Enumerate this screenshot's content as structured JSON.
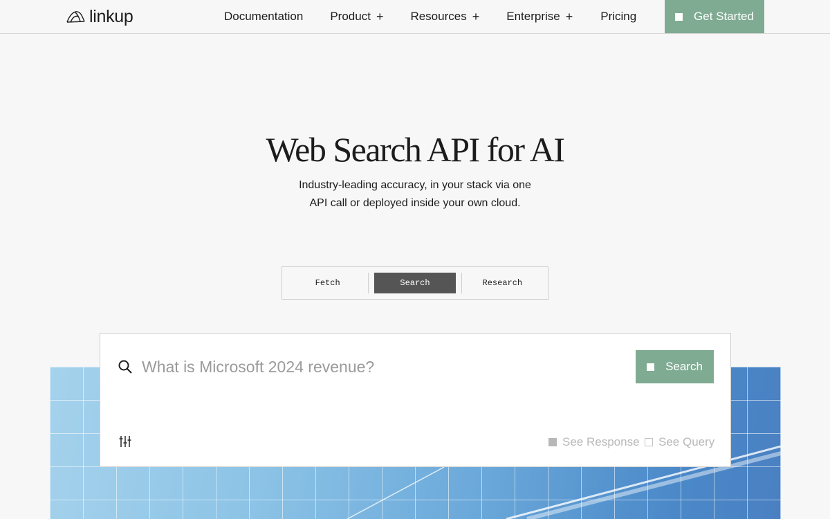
{
  "header": {
    "logo_text": "linkup",
    "nav": [
      {
        "label": "Documentation",
        "has_plus": false
      },
      {
        "label": "Product",
        "has_plus": true
      },
      {
        "label": "Resources",
        "has_plus": true
      },
      {
        "label": "Enterprise",
        "has_plus": true
      },
      {
        "label": "Pricing",
        "has_plus": false
      }
    ],
    "plus_glyph": "+",
    "cta_label": "Get Started"
  },
  "hero": {
    "title": "Web Search API for AI",
    "subtitle_line1": "Industry-leading accuracy, in your stack via one",
    "subtitle_line2": "API call or deployed inside your own cloud."
  },
  "tabs": [
    {
      "label": "Fetch",
      "active": false
    },
    {
      "label": "Search",
      "active": true
    },
    {
      "label": "Research",
      "active": false
    }
  ],
  "search": {
    "placeholder": "What is Microsoft 2024 revenue?",
    "value": "",
    "button_label": "Search",
    "options": [
      {
        "label": "See Response",
        "checked": true
      },
      {
        "label": "See Query",
        "checked": false
      }
    ]
  },
  "colors": {
    "accent": "#7fab92",
    "active_tab": "#555555",
    "background": "#f7f7f7",
    "sky_light": "#a5d2ec",
    "sky_dark": "#4a80c2"
  },
  "icons": [
    "linkup-logo-icon",
    "search-icon",
    "sliders-icon",
    "square-icon"
  ]
}
